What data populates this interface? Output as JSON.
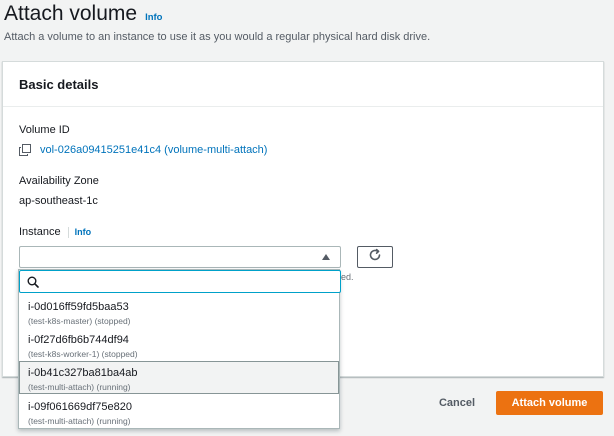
{
  "header": {
    "title": "Attach volume",
    "info_label": "Info",
    "description": "Attach a volume to an instance to use it as you would a regular physical hard disk drive."
  },
  "basic_details": {
    "title": "Basic details",
    "volume_id_label": "Volume ID",
    "volume_id_value": "vol-026a09415251e41c4 (volume-multi-attach)",
    "az_label": "Availability Zone",
    "az_value": "ap-southeast-1c",
    "instance_label": "Instance",
    "instance_info": "Info",
    "hint_fragment": "ed."
  },
  "instance_dropdown": {
    "search_value": "",
    "options": [
      {
        "id": "i-0d016ff59fd5baa53",
        "desc": "(test-k8s-master) (stopped)"
      },
      {
        "id": "i-0f27d6fb6b744df94",
        "desc": "(test-k8s-worker-1) (stopped)"
      },
      {
        "id": "i-0b41c327ba81ba4ab",
        "desc": "(test-multi-attach) (running)"
      },
      {
        "id": "i-09f061669df75e820",
        "desc": "(test-multi-attach) (running)"
      }
    ],
    "highlighted_index": 2
  },
  "footer": {
    "cancel_label": "Cancel",
    "attach_label": "Attach volume"
  },
  "colors": {
    "primary": "#ec7211",
    "link": "#0073bb",
    "focus": "#00a1c9"
  },
  "icons": {
    "copy": "copy-icon",
    "refresh": "refresh-icon",
    "search": "search-icon",
    "caret": "caret-up-icon"
  }
}
